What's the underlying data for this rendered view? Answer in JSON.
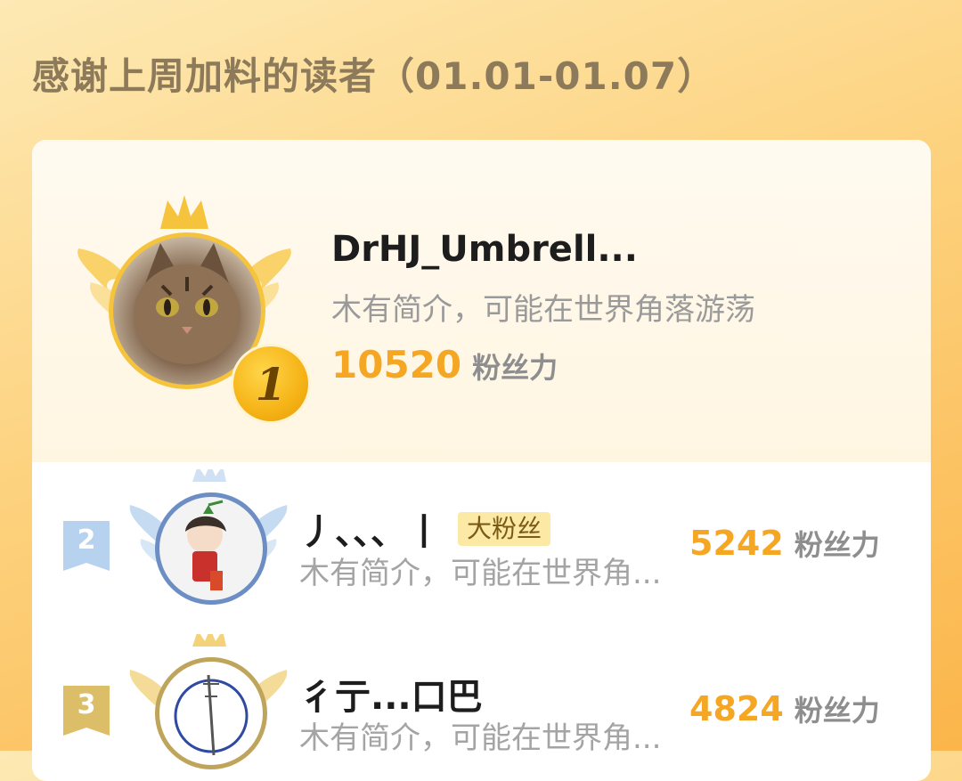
{
  "header": {
    "title": "感谢上周加料的读者（01.01-01.07）"
  },
  "first": {
    "rank": "1",
    "name": "DrHJ_Umbrell...",
    "bio": "木有简介，可能在世界角落游荡",
    "score": "10520",
    "score_unit": "粉丝力"
  },
  "rows": [
    {
      "rank": "2",
      "name": "丿、、、丨",
      "badge": "大粉丝",
      "bio": "木有简介，可能在世界角...",
      "score": "5242",
      "score_unit": "粉丝力"
    },
    {
      "rank": "3",
      "name": "彳亍...口巴",
      "bio": "木有简介，可能在世界角...",
      "score": "4824",
      "score_unit": "粉丝力"
    }
  ],
  "colors": {
    "accent": "#f5a623",
    "gold": "#f5c43c",
    "silver": "#b6d2ee",
    "bronze": "#d9bb6a"
  }
}
